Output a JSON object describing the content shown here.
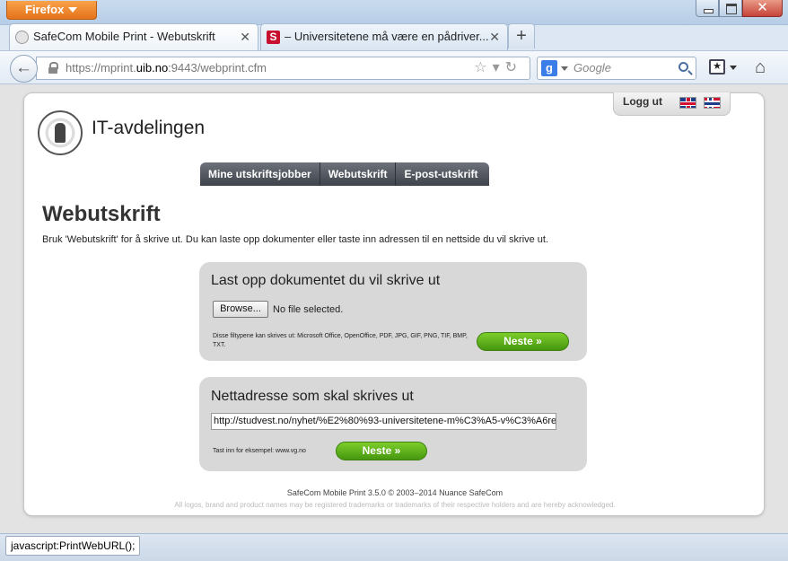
{
  "browser": {
    "menu_button": "Firefox",
    "close_glyph": "✕",
    "tabs": [
      {
        "title": "SafeCom Mobile Print - Webutskrift",
        "close": "✕",
        "favicon": "university-seal-icon"
      },
      {
        "title": "– Universitetene må være en pådriver...",
        "close": "✕",
        "favicon_letter": "S"
      }
    ],
    "new_tab": "+",
    "url": {
      "prefix": "https://mprint.",
      "host": "uib.no",
      "suffix": ":9443/webprint.cfm"
    },
    "search_placeholder": "Google",
    "search_engine_letter": "g",
    "status_text": "javascript:PrintWebURL();"
  },
  "page": {
    "logout": "Logg ut",
    "department": "IT-avdelingen",
    "menu": [
      "Mine utskriftsjobber",
      "Webutskrift",
      "E-post-utskrift"
    ],
    "heading": "Webutskrift",
    "intro": "Bruk 'Webutskrift' for å skrive ut. Du kan laste opp dokumenter eller taste inn adressen til en nettside du vil skrive ut.",
    "upload": {
      "title": "Last opp dokumentet du vil skrive ut",
      "browse": "Browse...",
      "no_file": "No file selected.",
      "filetypes": "Disse filtypene kan skrives ut: Microsoft Office, OpenOffice, PDF, JPG, GIF, PNG, TIF, BMP, TXT.",
      "next": "Neste »"
    },
    "web": {
      "title": "Nettadresse som skal skrives ut",
      "url_value": "http://studvest.no/nyhet/%E2%80%93-universitetene-m%C3%A5-v%C3%A6re",
      "example": "Tast inn for eksempel: www.vg.no",
      "next": "Neste »"
    },
    "footer": "SafeCom Mobile Print 3.5.0 © 2003–2014 Nuance SafeCom",
    "disclaimer": "All logos, brand and product names may be registered trademarks or trademarks of their respective holders and are hereby acknowledged."
  }
}
